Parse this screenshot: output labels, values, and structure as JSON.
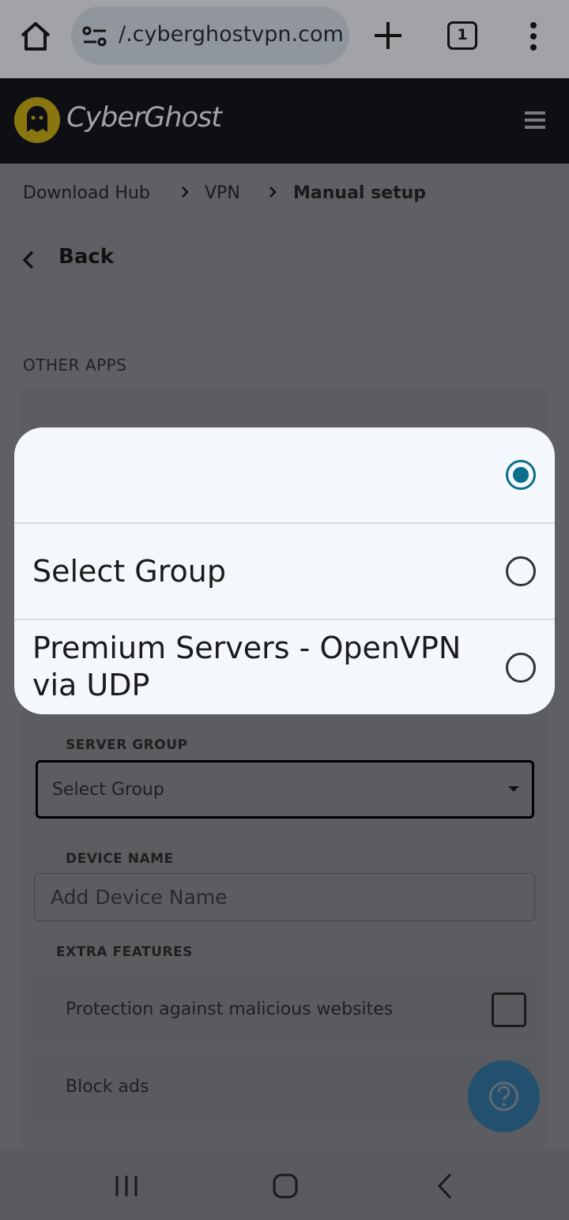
{
  "browser": {
    "url": "/.cyberghostvpn.com",
    "tab_count": "1"
  },
  "header": {
    "brand": "CyberGhost"
  },
  "breadcrumb": {
    "items": [
      "Download Hub",
      "VPN",
      "Manual setup"
    ]
  },
  "back_label": "Back",
  "section_title": "OTHER APPS",
  "form": {
    "server_group_label": "SERVER GROUP",
    "server_group_value": "Select Group",
    "device_name_label": "DEVICE NAME",
    "device_name_placeholder": "Add Device Name",
    "extra_features_label": "EXTRA FEATURES",
    "features": [
      {
        "label": "Protection against malicious websites",
        "checked": false
      },
      {
        "label": "Block ads",
        "checked": false
      }
    ]
  },
  "picker": {
    "options": [
      {
        "label": "",
        "selected": true
      },
      {
        "label": "Select Group",
        "selected": false
      },
      {
        "label": "Premium Servers - OpenVPN via UDP",
        "selected": false
      }
    ]
  },
  "colors": {
    "accent": "#0a6d8a",
    "brand_yellow": "#f1cc1f",
    "header_bg": "#0e0f14"
  }
}
